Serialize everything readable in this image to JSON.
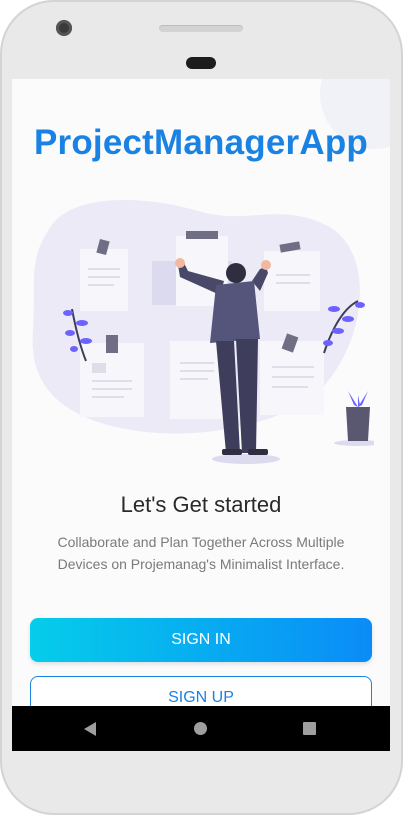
{
  "app": {
    "title": "ProjectManagerApp"
  },
  "onboarding": {
    "headline": "Let's Get started",
    "subtitle": "Collaborate and Plan Together Across Multiple Devices on Projemanag's Minimalist Interface."
  },
  "buttons": {
    "sign_in": "SIGN IN",
    "sign_up": "SIGN UP"
  },
  "colors": {
    "brand_blue": "#1a82e2",
    "gradient_start": "#05cdea",
    "gradient_end": "#0a8cf7",
    "illustration_accent": "#6c63ff"
  },
  "nav": {
    "back": "back-icon",
    "home": "home-icon",
    "recents": "recents-icon"
  }
}
